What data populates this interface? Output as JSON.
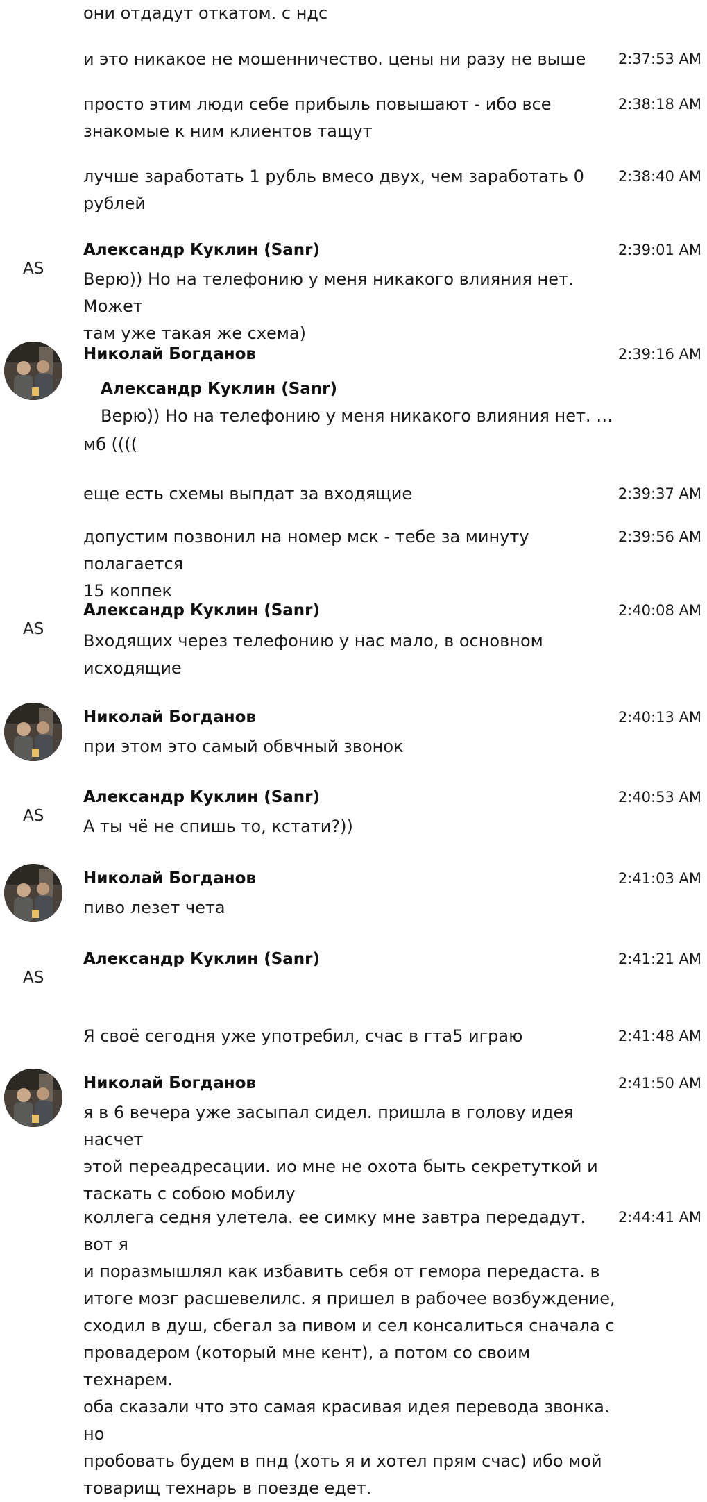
{
  "messages": [
    {
      "text": "они отдадут откатом. с ндс",
      "time": ""
    },
    {
      "text": "и это никакое не мошенничество. цены ни разу не выше",
      "time": "2:37:53 AM"
    },
    {
      "text": "просто этим люди себе прибыль повышают - ибо все\nзнакомые к ним клиентов тащут",
      "time": "2:38:18 AM"
    },
    {
      "text": "лучше заработать 1 рубль вмесо двух, чем заработать 0\nрублей",
      "time": "2:38:40 AM"
    },
    {
      "author": "Александр Куклин (Sanr)",
      "initials": "AS",
      "text": "Верю)) Но на телефонию у меня никакого влияния нет. Может\nтам уже такая же схема)",
      "time": "2:39:01 AM"
    },
    {
      "author": "Николай Богданов",
      "quote_author": "Александр Куклин (Sanr)",
      "quote_text": "Верю)) Но на телефонию у меня никакого влияния нет. Мо…",
      "text": "мб ((((",
      "time": "2:39:16 AM"
    },
    {
      "text": "еще есть схемы выпдат за входящие",
      "time": "2:39:37 AM"
    },
    {
      "text": "допустим позвонил на номер мск - тебе за минуту полагается\n15 коппек",
      "time": "2:39:56 AM"
    },
    {
      "author": "Александр Куклин (Sanr)",
      "initials": "AS",
      "text": "Входящих через телефонию у нас мало, в основном\nисходящие",
      "time": "2:40:08 AM"
    },
    {
      "author": "Николай Богданов",
      "text": "при этом это самый обвчный звонок",
      "time": "2:40:13 AM"
    },
    {
      "author": "Александр Куклин (Sanr)",
      "initials": "AS",
      "text": "А ты чё не спишь то, кстати?))",
      "time": "2:40:53 AM"
    },
    {
      "author": "Николай Богданов",
      "text": "пиво лезет чета",
      "time": "2:41:03 AM"
    },
    {
      "author": "Александр Куклин (Sanr)",
      "initials": "AS",
      "text": "",
      "time": "2:41:21 AM"
    },
    {
      "text": "Я своё сегодня уже употребил, счас в гта5 играю",
      "time": "2:41:48 AM"
    },
    {
      "author": "Николай Богданов",
      "text": "я в 6 вечера уже засыпал сидел. пришла в голову идея насчет\nэтой переадресации. ио мне не охота быть секретуткой и\nтаскать с собою мобилу",
      "time": "2:41:50 AM"
    },
    {
      "text": "коллега седня улетела. ее симку мне завтра передадут. вот я\nи поразмышлял как избавить себя от гемора передаста. в\nитоге мозг расшевелилс. я пришел в рабочее возбуждение,\nсходил в душ, сбегал за пивом и сел консалиться сначала с\nпровадером (который мне кент), а потом со своим технарем.\nоба сказали что это самая красивая идея перевода звонка. но\nпробовать будем в пнд (хоть я и хотел прям счас) ибо мой\nтоварищ технарь в поезде едет.",
      "time": "2:44:41 AM"
    }
  ]
}
